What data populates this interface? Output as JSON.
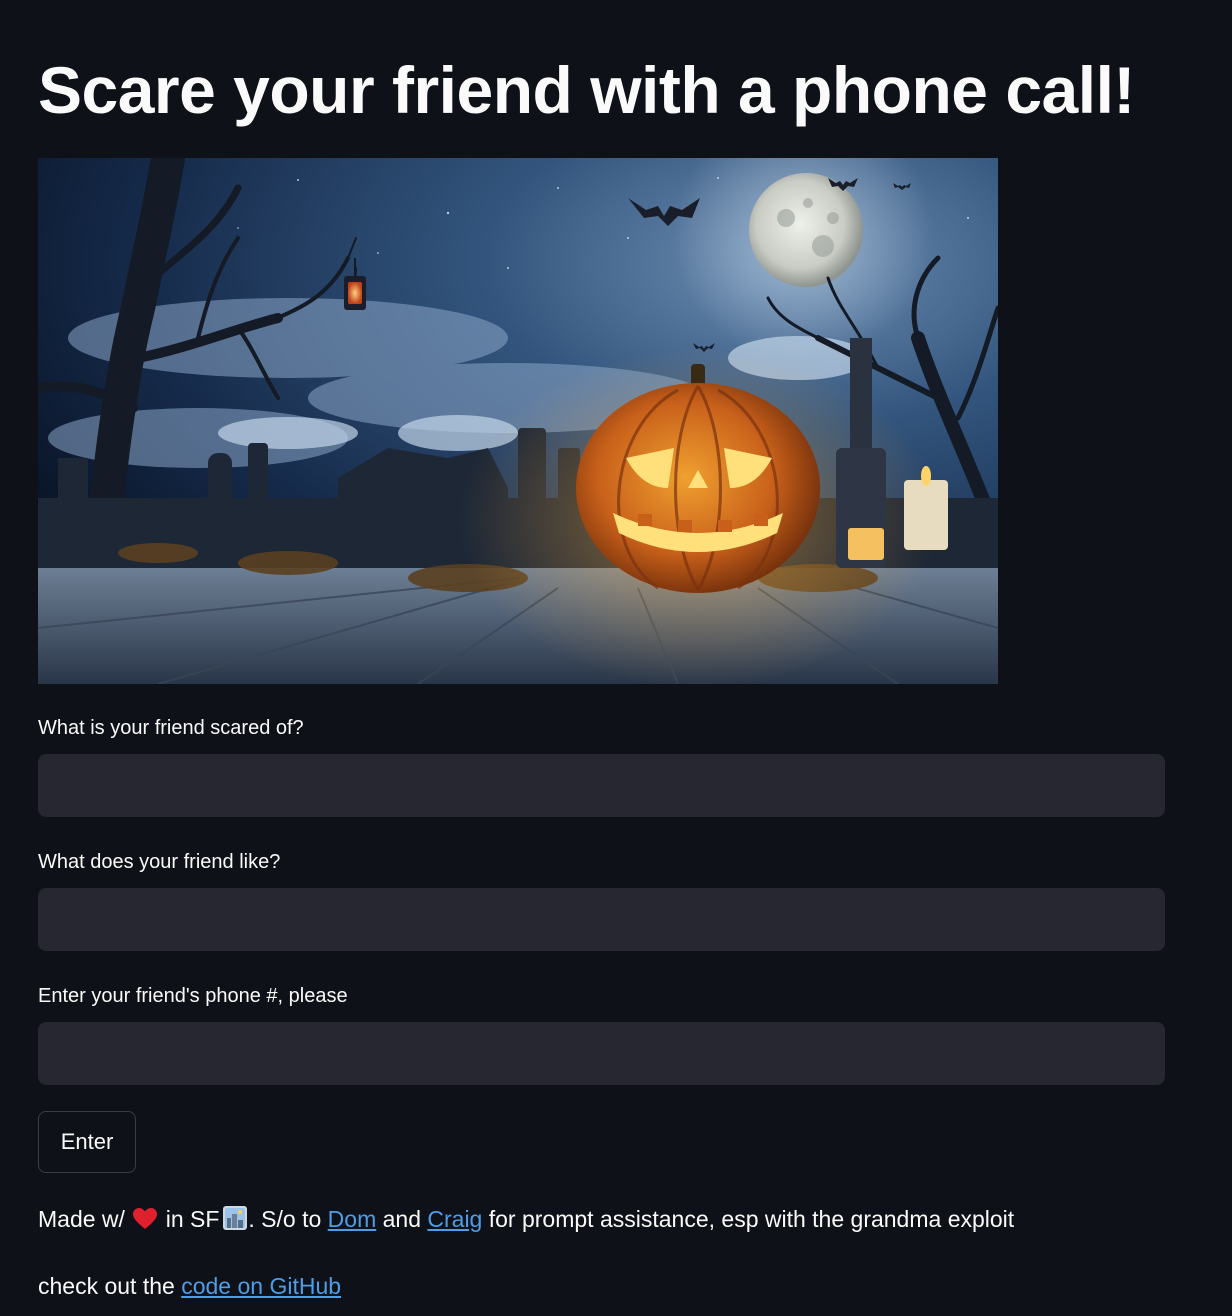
{
  "app": {
    "title": "Scare your friend with a phone call!"
  },
  "hero_image": {
    "alt": "Halloween jack-o'-lantern under a full moon"
  },
  "form": {
    "fears": {
      "label": "What is your friend scared of?",
      "value": "",
      "placeholder": ""
    },
    "likes": {
      "label": "What does your friend like?",
      "value": "",
      "placeholder": ""
    },
    "phone": {
      "label": "Enter your friend's phone #, please",
      "value": "",
      "placeholder": ""
    },
    "submit_label": "Enter"
  },
  "footer": {
    "made_prefix": "Made w/",
    "made_in": "in SF",
    "shoutout_prefix": ". S/o to",
    "link_dom": "Dom",
    "and_text": "and",
    "link_craig": "Craig",
    "shoutout_suffix": "for prompt assistance, esp with the grandma exploit",
    "github_prefix": "check out the",
    "github_link": "code on GitHub",
    "heart_icon": "red-heart-icon",
    "city_icon": "cityscape-icon"
  },
  "colors": {
    "background": "#0e1117",
    "input_background": "#262730",
    "text": "#fafafa",
    "link": "#4d9de8"
  }
}
